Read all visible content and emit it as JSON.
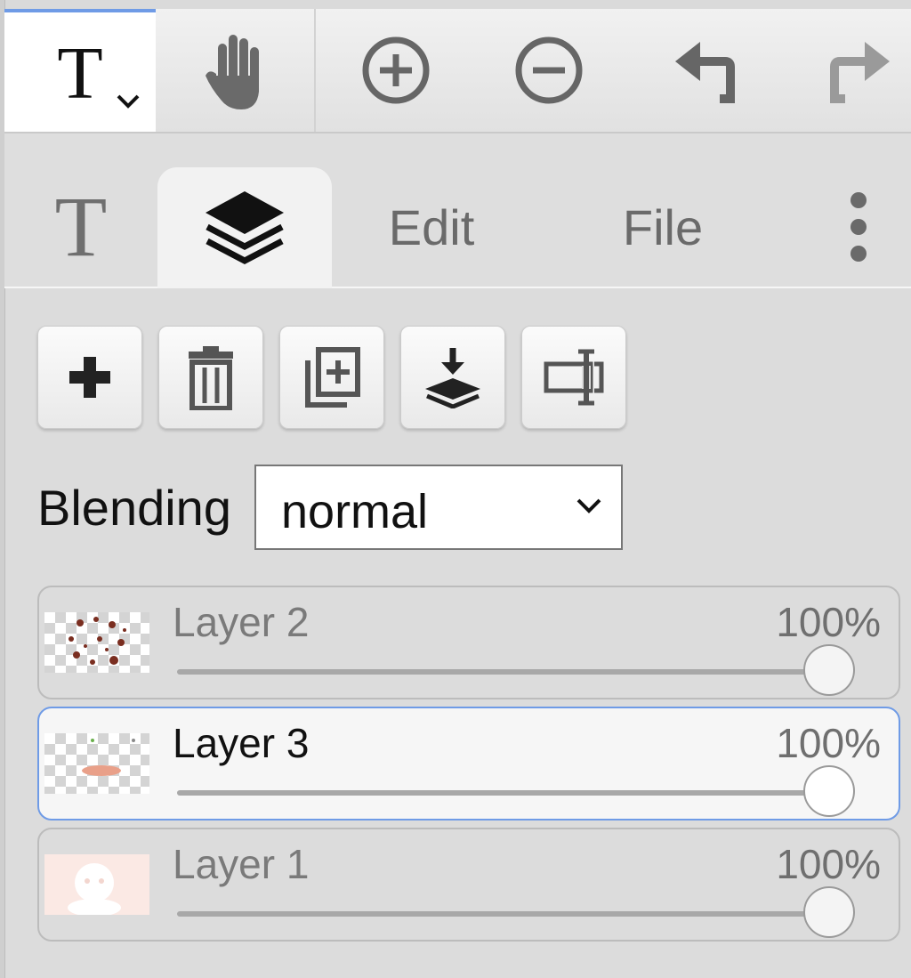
{
  "toolbar": {
    "active_tool": "text-tool",
    "active_tool_glyph": "T",
    "tools": [
      "text-tool",
      "hand-tool",
      "zoom-in",
      "zoom-out",
      "undo",
      "redo"
    ]
  },
  "tabs": {
    "text_glyph": "T",
    "layers_icon": "layers-icon",
    "edit_label": "Edit",
    "file_label": "File",
    "more_icon": "more-vertical-icon"
  },
  "actions": [
    "add-layer",
    "delete-layer",
    "duplicate-layer",
    "merge-down",
    "rename-layer"
  ],
  "blending": {
    "label": "Blending",
    "value": "normal"
  },
  "layers": [
    {
      "name": "Layer 2",
      "opacity": "100%",
      "opacity_fraction": 1.0,
      "active": false
    },
    {
      "name": "Layer 3",
      "opacity": "100%",
      "opacity_fraction": 1.0,
      "active": true
    },
    {
      "name": "Layer 1",
      "opacity": "100%",
      "opacity_fraction": 1.0,
      "active": false
    }
  ],
  "colors": {
    "accent": "#6f9be6",
    "panel_bg": "#dcdcdc"
  }
}
